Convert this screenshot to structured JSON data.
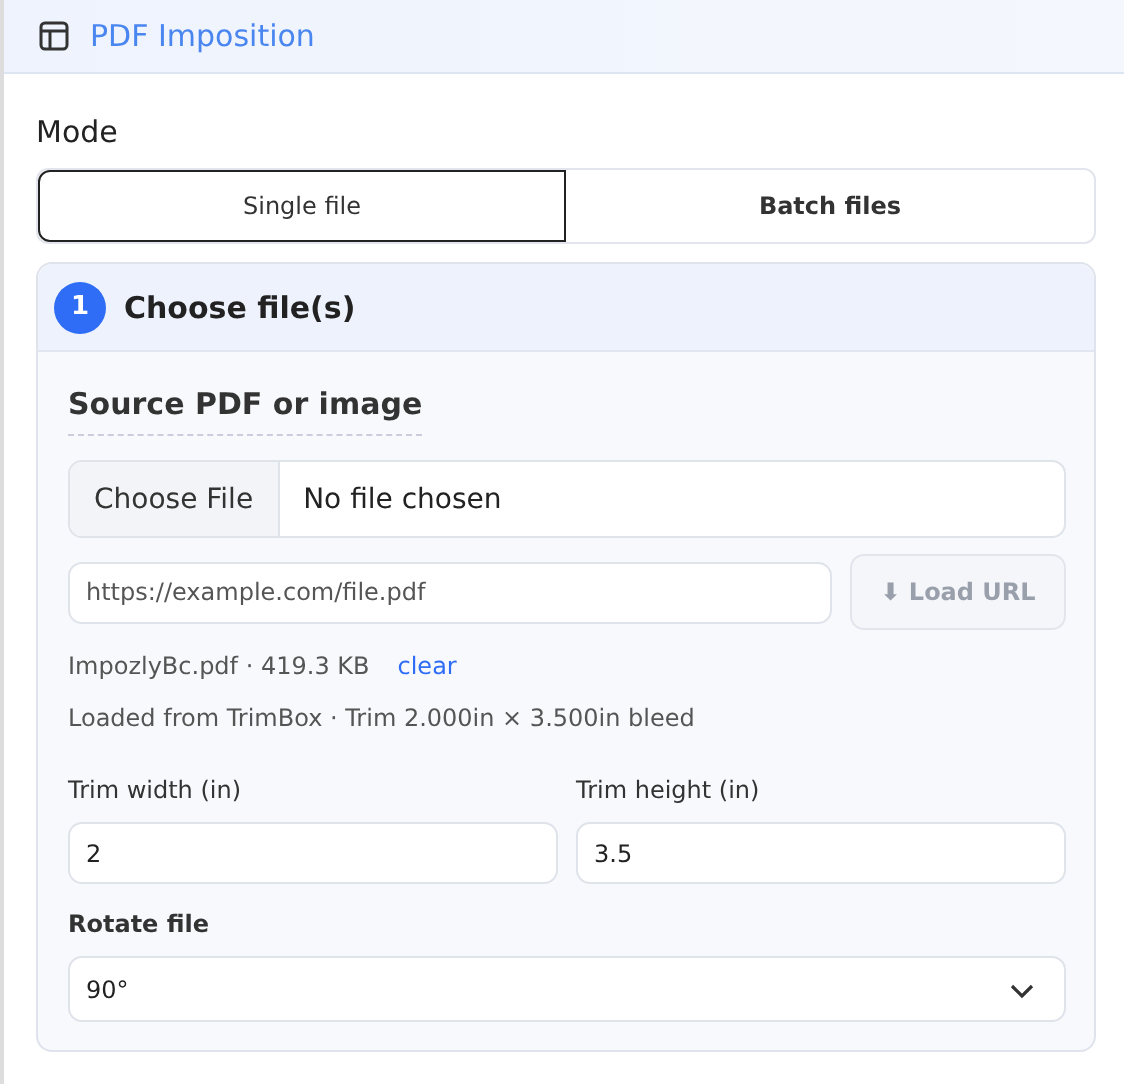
{
  "header": {
    "title": "PDF Imposition"
  },
  "mode": {
    "label": "Mode",
    "options": [
      {
        "label": "Single file",
        "selected": true
      },
      {
        "label": "Batch files",
        "selected": false
      }
    ]
  },
  "step": {
    "number": "1",
    "title": "Choose file(s)"
  },
  "source": {
    "heading": "Source PDF or image",
    "file_button": "Choose File",
    "file_status": "No file chosen",
    "url_placeholder": "https://example.com/file.pdf",
    "load_button": "⬇ Load URL",
    "load_disabled": true,
    "file_info": "ImpozlyBc.pdf · 419.3 KB",
    "clear_link": "clear",
    "loaded_note": "Loaded from TrimBox · Trim 2.000in × 3.500in bleed"
  },
  "trim": [
    {
      "label": "Trim width (in)",
      "value": "2"
    },
    {
      "label": "Trim height (in)",
      "value": "3.5"
    }
  ],
  "rotate": {
    "label": "Rotate file",
    "value": "90°"
  }
}
